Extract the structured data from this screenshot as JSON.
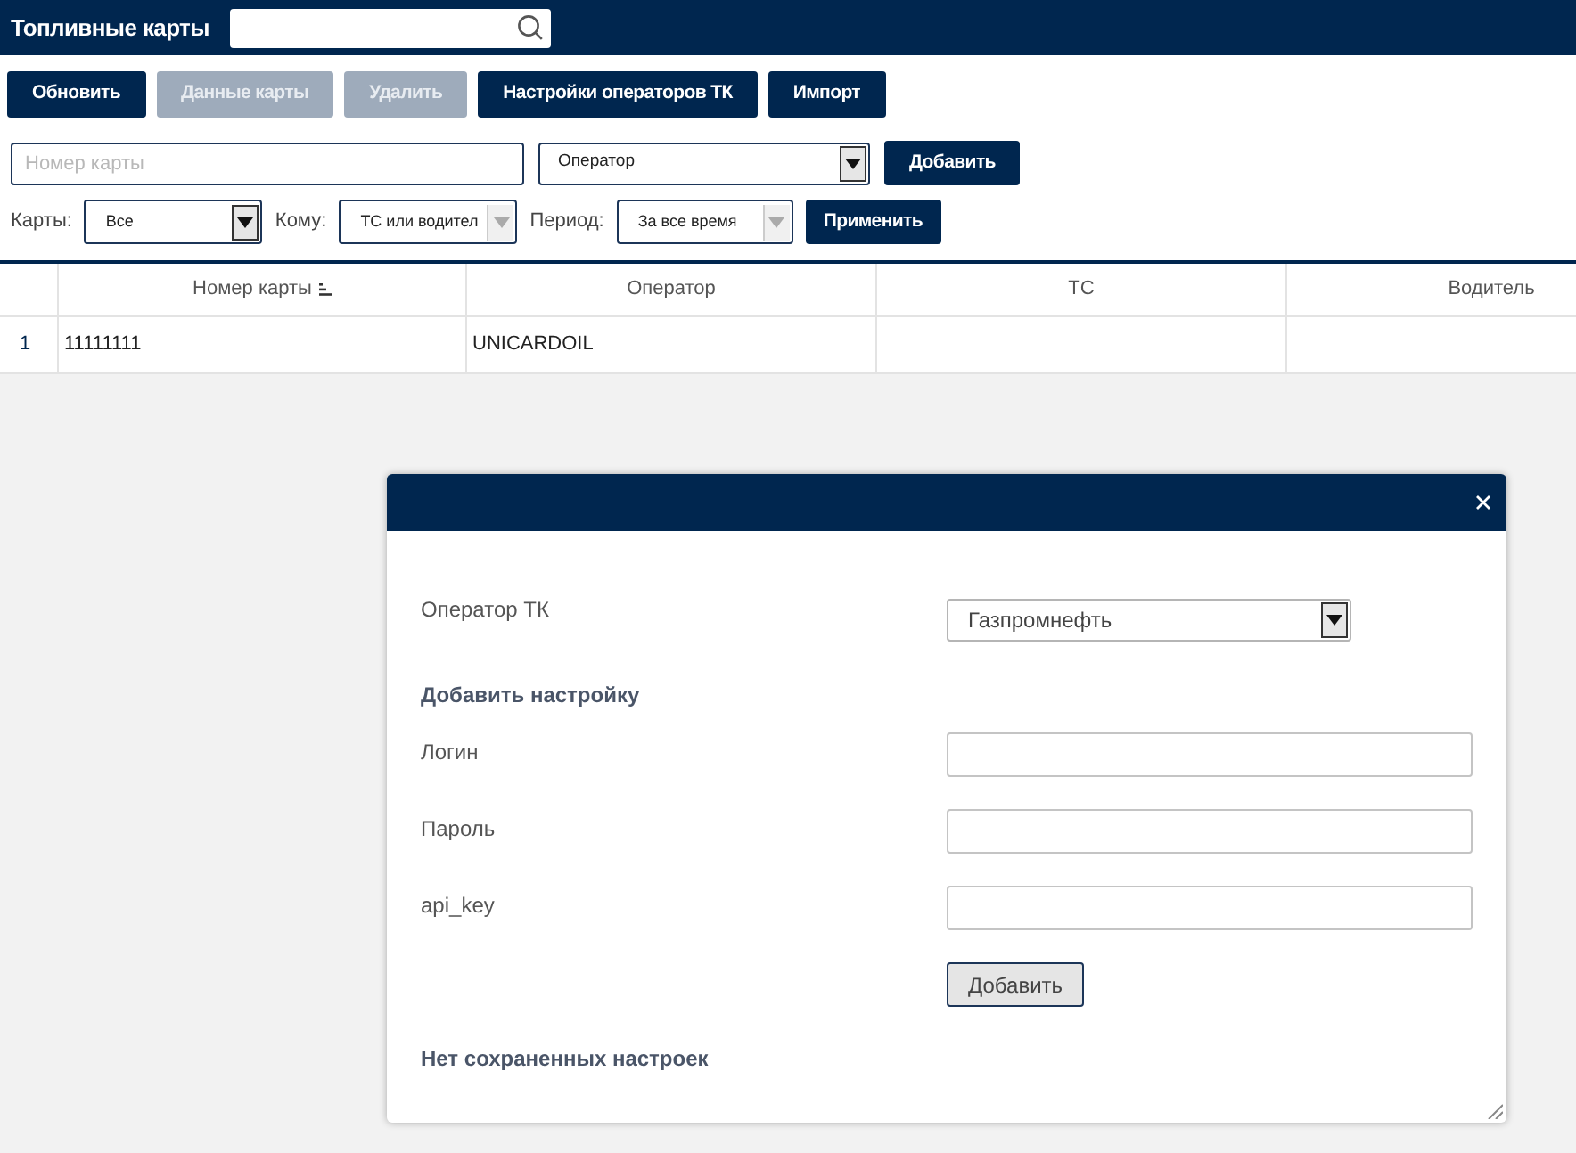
{
  "header": {
    "title": "Топливные карты"
  },
  "toolbar": [
    {
      "label": "Обновить",
      "disabled": false
    },
    {
      "label": "Данные карты",
      "disabled": true
    },
    {
      "label": "Удалить",
      "disabled": true
    },
    {
      "label": "Настройки операторов ТК",
      "disabled": false
    },
    {
      "label": "Импорт",
      "disabled": false
    }
  ],
  "add_form": {
    "card_number": {
      "placeholder": "Номер карты"
    },
    "operator": {
      "value": "Оператор"
    },
    "add_button": "Добавить"
  },
  "filters": [
    {
      "label": "Карты:",
      "value": "Все",
      "disabled": false
    },
    {
      "label": "Кому:",
      "value": "ТС или водител",
      "disabled": true
    },
    {
      "label": "Период:",
      "value": "За все время",
      "disabled": true
    }
  ],
  "apply_button": "Применить",
  "table": {
    "columns": [
      {
        "label": "Номер карты",
        "sorted": true
      },
      {
        "label": "Оператор",
        "sorted": false
      },
      {
        "label": "ТС",
        "sorted": false
      },
      {
        "label": "Водитель",
        "sorted": false
      }
    ],
    "rows": [
      {
        "index": "1",
        "cells": [
          "11111111",
          "UNICARDOIL"
        ]
      }
    ]
  },
  "modal": {
    "operator_label": "Оператор ТК",
    "operator_value": "Газпромнефть",
    "section_title": "Добавить настройку",
    "fields": [
      {
        "label": "Логин"
      },
      {
        "label": "Пароль"
      },
      {
        "label": "api_key"
      }
    ],
    "add_button": "Добавить",
    "empty_message": "Нет сохраненных настроек"
  }
}
